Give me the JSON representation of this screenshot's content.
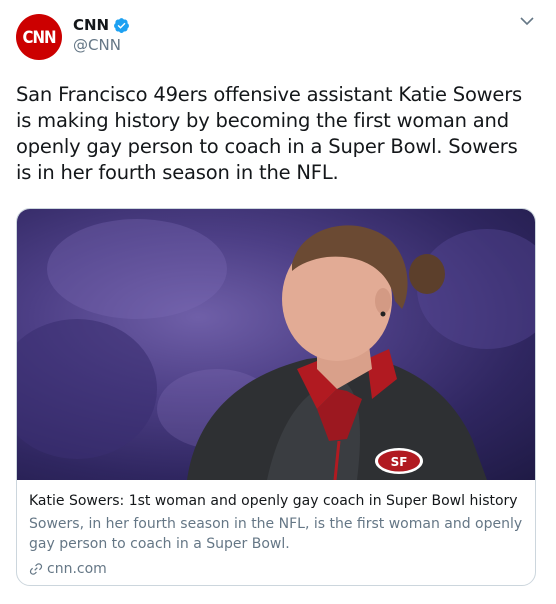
{
  "account": {
    "avatar_text": "CNN",
    "display_name": "CNN",
    "handle": "@CNN",
    "verified": true
  },
  "tweet": {
    "text": "San Francisco 49ers offensive assistant Katie Sowers is making history by becoming the first woman and openly gay person to coach in a Super Bowl. Sowers is in her fourth season in the NFL."
  },
  "card": {
    "title": "Katie Sowers: 1st woman and openly gay coach in Super Bowl history",
    "description": "Sowers, in her fourth season in the NFL, is the first woman and openly gay person to coach in a Super Bowl.",
    "domain": "cnn.com",
    "image_logo_text": "SF"
  },
  "colors": {
    "brand": "#cc0000",
    "verified": "#1da1f2",
    "secondary_text": "#657786",
    "border": "#ccd6dd"
  },
  "icons": {
    "verified": "verified-badge-icon",
    "caret": "chevron-down-icon",
    "link": "link-icon"
  }
}
